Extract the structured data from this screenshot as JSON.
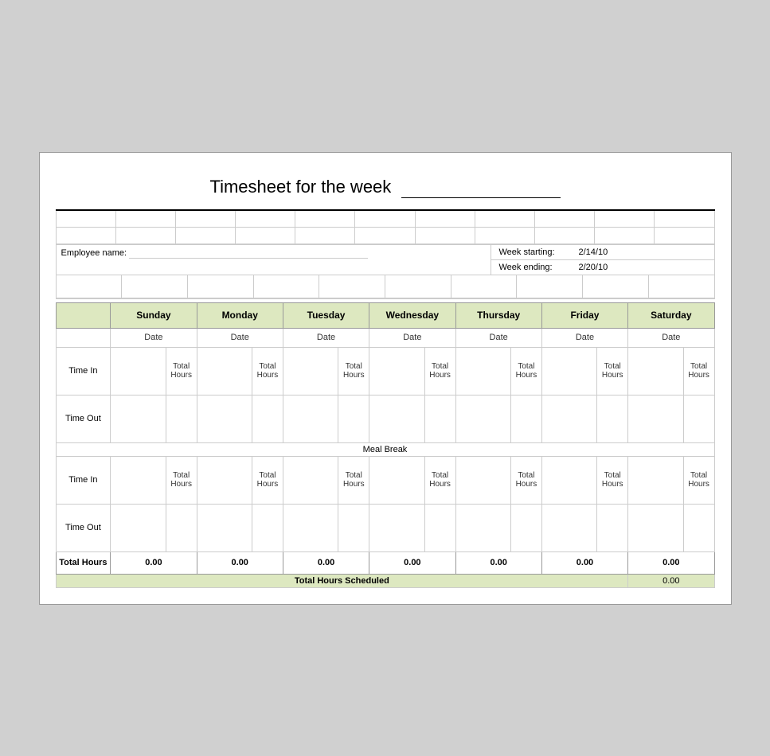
{
  "title": {
    "text": "Timesheet for the week",
    "underline_placeholder": ""
  },
  "employee": {
    "label": "Employee name:",
    "value": ""
  },
  "week": {
    "starting_label": "Week starting:",
    "starting_value": "2/14/10",
    "ending_label": "Week ending:",
    "ending_value": "2/20/10"
  },
  "days": {
    "headers": [
      "Sunday",
      "Monday",
      "Tuesday",
      "Wednesday",
      "Thursday",
      "Friday",
      "Saturday"
    ],
    "date_label": "Date"
  },
  "rows": {
    "time_in_label": "Time In",
    "time_out_label": "Time Out",
    "total_hours_label": "Total Hours",
    "hours_label": "Hours",
    "meal_break_label": "Meal Break",
    "total_hours_row_label": "Total Hours",
    "total_hours_scheduled_label": "Total Hours Scheduled"
  },
  "values": {
    "sunday": "0.00",
    "monday": "0.00",
    "tuesday": "0.00",
    "wednesday": "0.00",
    "thursday": "0.00",
    "friday": "0.00",
    "saturday": "0.00",
    "total_scheduled": "0.00"
  },
  "colors": {
    "header_bg": "#dde8c0",
    "page_bg": "#ffffff"
  }
}
